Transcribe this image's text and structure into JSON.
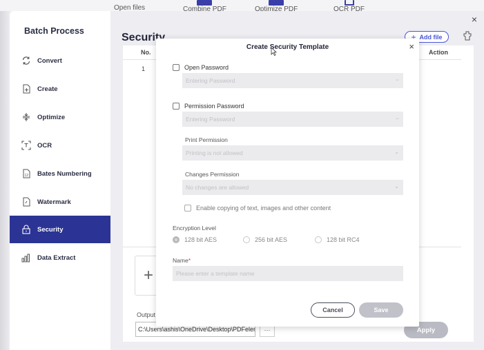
{
  "toolbar": {
    "items": [
      {
        "label": "Open files",
        "icon": "folder-icon"
      },
      {
        "label": "Combine PDF",
        "icon": "combine-icon"
      },
      {
        "label": "Optimize PDF",
        "icon": "optimize-icon"
      },
      {
        "label": "OCR PDF",
        "icon": "ocr-icon"
      }
    ]
  },
  "sidebar": {
    "title": "Batch Process",
    "items": [
      {
        "label": "Convert",
        "icon": "convert-icon",
        "active": false
      },
      {
        "label": "Create",
        "icon": "create-icon",
        "active": false
      },
      {
        "label": "Optimize",
        "icon": "optimize-icon",
        "active": false
      },
      {
        "label": "OCR",
        "icon": "ocr-icon",
        "active": false
      },
      {
        "label": "Bates Numbering",
        "icon": "bates-icon",
        "active": false
      },
      {
        "label": "Watermark",
        "icon": "watermark-icon",
        "active": false
      },
      {
        "label": "Security",
        "icon": "lock-icon",
        "active": true
      },
      {
        "label": "Data Extract",
        "icon": "chart-icon",
        "active": false
      }
    ],
    "active_color": "#2b3494"
  },
  "main": {
    "title": "Security",
    "add_file_label": "Add file",
    "table": {
      "columns": [
        "No.",
        "Action"
      ],
      "rows": [
        {
          "no": "1"
        }
      ]
    },
    "add_symbol": "+",
    "output_label": "Output",
    "output_path": "C:\\Users\\ashis\\OneDrive\\Desktop\\PDFelement",
    "browse_label": "···",
    "apply_label": "Apply",
    "close_symbol": "×"
  },
  "modal": {
    "title": "Create Security Template",
    "close_symbol": "×",
    "open_password": {
      "label": "Open Password",
      "checked": false,
      "placeholder": "Entering Password"
    },
    "permission_password": {
      "label": "Permission Password",
      "checked": false,
      "placeholder": "Entering Password"
    },
    "print_permission": {
      "label": "Print Permission",
      "value": "Printing is not allowed"
    },
    "changes_permission": {
      "label": "Changes Permission",
      "value": "No changes are allowed"
    },
    "enable_copying": {
      "label": "Enable copying of text, images and other content",
      "checked": false
    },
    "encryption": {
      "label": "Encryption Level",
      "options": [
        "128 bit AES",
        "256 bit AES",
        "128 bit RC4"
      ],
      "selected": "128 bit AES"
    },
    "name": {
      "label": "Name",
      "required_mark": "*",
      "placeholder": "Please enter a template name"
    },
    "cancel_label": "Cancel",
    "save_label": "Save"
  },
  "colors": {
    "accent": "#4a55d8",
    "sidebar_active": "#2b3494",
    "disabled_button": "#c0c1c9"
  }
}
